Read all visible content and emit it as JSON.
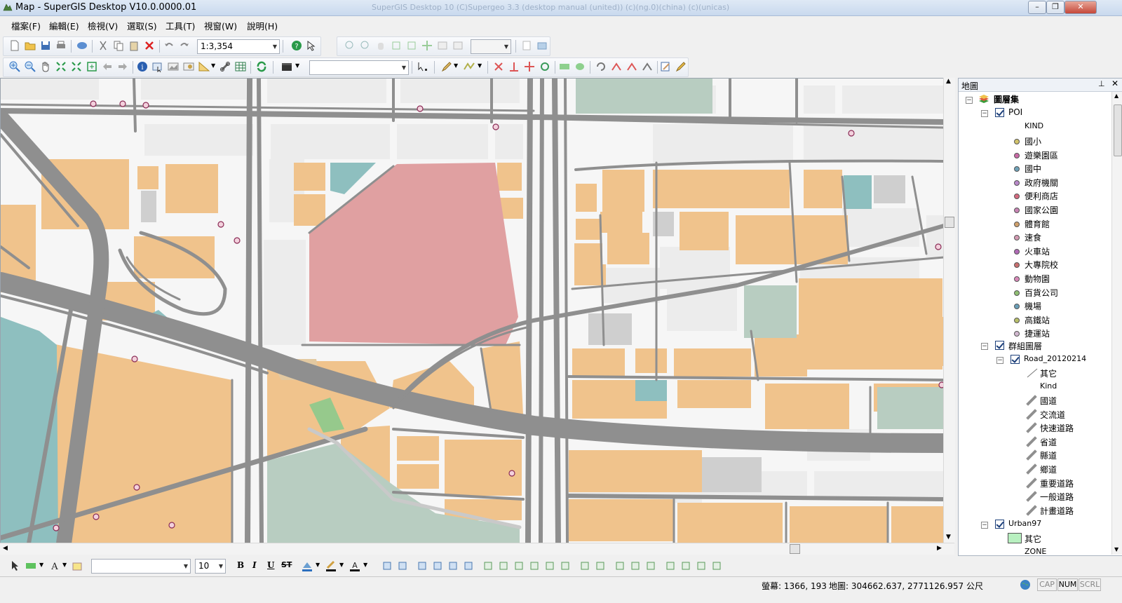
{
  "window": {
    "title": "Map - SuperGIS Desktop V10.0.0000.01",
    "ghost_title": "SuperGIS Desktop 10 (C)Supergeo 3.3 (desktop manual (united)) (c)(ng.0)(china) (c)(unicas)"
  },
  "menu": {
    "items": [
      "檔案(F)",
      "編輯(E)",
      "檢視(V)",
      "選取(S)",
      "工具(T)",
      "視窗(W)",
      "說明(H)"
    ]
  },
  "toolbar": {
    "scale": "1:3,354",
    "font_size": "10",
    "font_name": "",
    "layer_combo": "",
    "zoom_combo": ""
  },
  "panel": {
    "title": "地圖",
    "pin_icon": "pin-icon",
    "close_icon": "close-icon"
  },
  "tree": {
    "root": "圖層集",
    "poi": {
      "name": "POI",
      "field": "KIND",
      "classes": [
        {
          "label": "國小",
          "color": "#d2c36b"
        },
        {
          "label": "遊樂園區",
          "color": "#c96aa6"
        },
        {
          "label": "國中",
          "color": "#6fa2b8"
        },
        {
          "label": "政府機關",
          "color": "#b888c9"
        },
        {
          "label": "便利商店",
          "color": "#d56a7f"
        },
        {
          "label": "國家公園",
          "color": "#c884b4"
        },
        {
          "label": "體育館",
          "color": "#cfa06c"
        },
        {
          "label": "速食",
          "color": "#d39ab2"
        },
        {
          "label": "火車站",
          "color": "#b06ab6"
        },
        {
          "label": "大專院校",
          "color": "#c86f6f"
        },
        {
          "label": "動物園",
          "color": "#d989b9"
        },
        {
          "label": "百貨公司",
          "color": "#8fbf72"
        },
        {
          "label": "機場",
          "color": "#6a9fb8"
        },
        {
          "label": "高鐵站",
          "color": "#b8bf6a"
        },
        {
          "label": "捷運站",
          "color": "#d1b8cf"
        }
      ]
    },
    "group": {
      "name": "群組圖層",
      "road": {
        "name": "Road_20120214",
        "other": "其它",
        "field": "Kind",
        "classes": [
          "國道",
          "交流道",
          "快速道路",
          "省道",
          "縣道",
          "鄉道",
          "重要道路",
          "一般道路",
          "計畫道路"
        ]
      }
    },
    "urban": {
      "name": "Urban97",
      "other": "其它",
      "field": "ZONE"
    }
  },
  "status": {
    "screen": "螢幕: 1366, 193",
    "map": "地圖: 304662.637, 2771126.957 公尺",
    "cap": "CAP",
    "num": "NUM",
    "scrl": "SCRL"
  },
  "colors": {
    "residential": "#f0c38c",
    "parcel": "#ececec",
    "road": "#8f8f8f",
    "park": "#b8cdc1",
    "water": "#8ebfbf",
    "commercial": "#e0a0a1",
    "green": "#96c98c",
    "poi_marker": "#d97aa6"
  }
}
